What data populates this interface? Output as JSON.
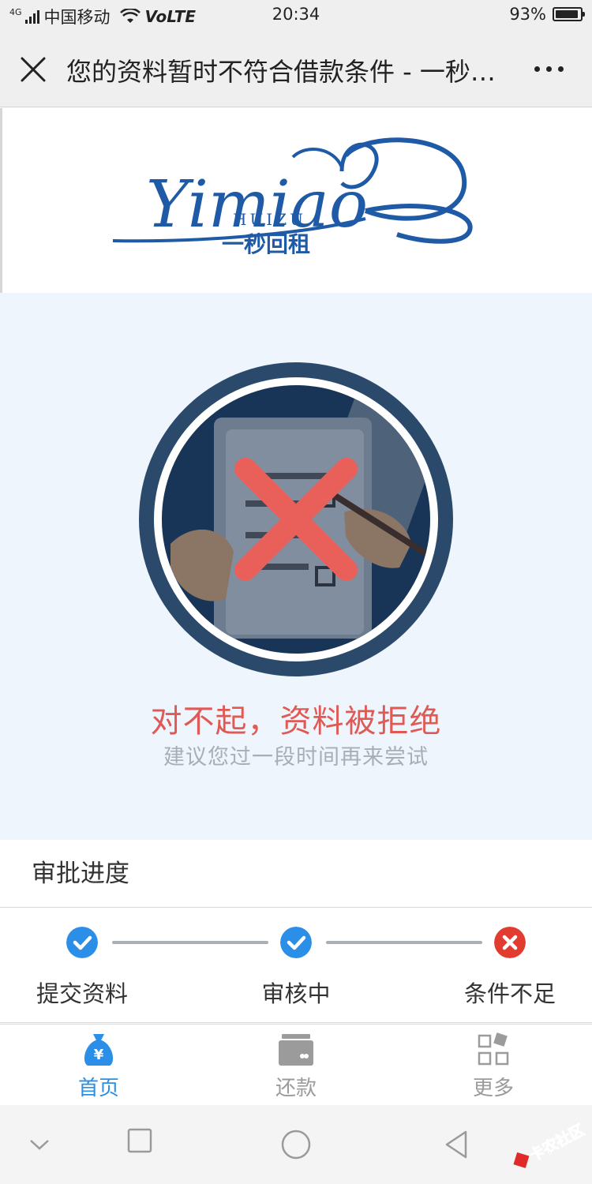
{
  "status_bar": {
    "signal_label": "4G",
    "carrier": "中国移动",
    "volte": "VoLTE",
    "time": "20:34",
    "battery_percent": "93%",
    "battery_level": 0.93
  },
  "nav": {
    "title": "您的资料暂时不符合借款条件 - 一秒回租"
  },
  "banner": {
    "logo_script": "Yimiao",
    "logo_subscript": "HUIZU",
    "logo_chinese": "一秒回租"
  },
  "result": {
    "title": "对不起，资料被拒绝",
    "subtitle": "建议您过一段时间再来尝试"
  },
  "progress": {
    "header": "审批进度",
    "steps": [
      {
        "label": "提交资料",
        "status": "done",
        "icon": "check-icon"
      },
      {
        "label": "审核中",
        "status": "done",
        "icon": "check-icon"
      },
      {
        "label": "条件不足",
        "status": "failed",
        "icon": "x-icon"
      }
    ]
  },
  "tabbar": {
    "tabs": [
      {
        "label": "首页",
        "icon": "money-bag-icon",
        "active": true
      },
      {
        "label": "还款",
        "icon": "card-icon",
        "active": false
      },
      {
        "label": "更多",
        "icon": "grid-icon",
        "active": false
      }
    ]
  },
  "watermark": {
    "text": "卡农社区"
  },
  "colors": {
    "accent": "#2b8fe7",
    "reject": "#e05a55",
    "fail_icon": "#e13c2f",
    "result_bg": "#eef5fd",
    "ring": "#2b4a6b",
    "inactive_tab": "#9b9b9b"
  }
}
